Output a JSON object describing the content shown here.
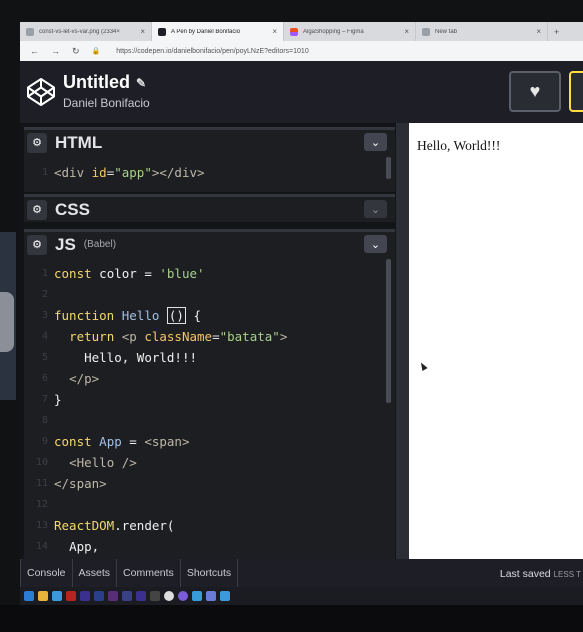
{
  "browser": {
    "tabs": [
      {
        "label": "const-vs-let-vs-var.png (2334×",
        "favicon": "image-icon",
        "active": false
      },
      {
        "label": "A Pen by Daniel Bonifacio",
        "favicon": "codepen-icon",
        "active": true
      },
      {
        "label": "AlgaShopping – Figma",
        "favicon": "figma-icon",
        "active": false
      },
      {
        "label": "New tab",
        "favicon": "page-icon",
        "active": false
      }
    ],
    "close_glyph": "×",
    "new_tab_glyph": "+",
    "url": "https://codepen.io/danielbonifacio/pen/poyLNzE?editors=1010"
  },
  "header": {
    "title": "Untitled",
    "author": "Daniel Bonifacio",
    "heart_glyph": "♥",
    "pencil_glyph": "✎"
  },
  "editors": {
    "html": {
      "name": "HTML",
      "lines": [
        {
          "n": "1"
        }
      ]
    },
    "css": {
      "name": "CSS"
    },
    "js": {
      "name": "JS",
      "sub": "(Babel)",
      "line_numbers": [
        "1",
        "2",
        "3",
        "4",
        "5",
        "6",
        "7",
        "8",
        "9",
        "10",
        "11",
        "12",
        "13",
        "14"
      ]
    },
    "gear_glyph": "⚙",
    "chevron_glyph": "⌄"
  },
  "code": {
    "html_line": {
      "open": "<div",
      "attr": " id",
      "eq": "=",
      "val": "\"app\"",
      "close": "></div>"
    },
    "js": {
      "l1": {
        "kw": "const",
        "rest": " color = ",
        "str": "'blue'"
      },
      "l3": {
        "kw": "function",
        "name": " Hello ",
        "paren": "()",
        "brace": " {"
      },
      "l4": {
        "kw": "return",
        "tag": " <p",
        "attr": " className",
        "eq": "=",
        "str": "\"batata\"",
        "gt": ">"
      },
      "l5": {
        "text": "Hello, World!!!"
      },
      "l6": {
        "tag": "</p>"
      },
      "l7": {
        "brace": "}"
      },
      "l9": {
        "kw": "const",
        "name": " App",
        "eq": " = ",
        "tag": "<span>"
      },
      "l10": {
        "tag": "<Hello />"
      },
      "l11": {
        "tag": "</span>"
      },
      "l13": {
        "obj": "ReactDOM",
        "method": ".render("
      },
      "l14": {
        "arg": "App,"
      }
    }
  },
  "preview": {
    "text": "Hello, World!!!"
  },
  "footer": {
    "buttons": [
      "Console",
      "Assets",
      "Comments",
      "Shortcuts"
    ],
    "last_saved": "Last saved",
    "last_saved_suffix": "LESS T"
  },
  "colors": {
    "background": "#131417",
    "editor": "#1d1e22",
    "accent_yellow": "#ffdd40",
    "preview_bg": "#ffffff"
  }
}
